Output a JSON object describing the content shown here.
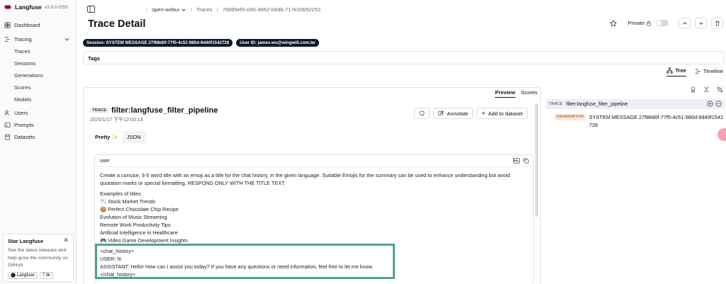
{
  "brand": {
    "name": "Langfuse",
    "version": "v3.8.0 OSS",
    "logo_color": "#c83c4f"
  },
  "sidebar": {
    "dashboard": "Dashboard",
    "tracing": "Tracing",
    "tracing_items": [
      "Traces",
      "Sessions",
      "Generations",
      "Scores",
      "Models"
    ],
    "users": "Users",
    "prompts": "Prompts",
    "datasets": "Datasets"
  },
  "star_card": {
    "title": "Star Langfuse",
    "text": "See the latest releases and help grow the community on GitHub",
    "github_label": "Langfuse",
    "github_count": "7.8k"
  },
  "breadcrumb": {
    "project": "open-webui",
    "section": "Traces",
    "trace_id": "76885ef9-cbfc-4662-b6db-717e20b52252"
  },
  "page_title": "Trace Detail",
  "privacy_label": "Private",
  "pills": {
    "session": "Session: SYSTEM MESSAGE 27f88d0f-77f5-4c51-980d-9d40f1542728",
    "user": "User ID: james.wu@wingwill.com.tw"
  },
  "tags_label": "Tags",
  "view_tabs": {
    "tree": "Tree",
    "timeline": "Timeline"
  },
  "main": {
    "tabs": {
      "preview": "Preview",
      "scores": "Scores"
    },
    "trace_badge": "TRACE",
    "trace_name": "filter:langfuse_filter_pipeline",
    "timestamp": "2025/1/17 下午12:03:13",
    "annotate": "Annotate",
    "add_dataset": "Add to dataset",
    "seg": {
      "pretty": "Pretty ✨",
      "json": "JSON"
    },
    "msg_role": "user",
    "instruction": "Create a concise, 3-5 word title with an emoji as a title for the chat history, in the given language. Suitable Emojis for the summary can be used to enhance understanding but avoid quotation marks or special formatting. RESPOND ONLY WITH THE TITLE TEXT.",
    "examples_heading": "Examples of titles:",
    "examples": [
      "📉 Stock Market Trends",
      "🍪 Perfect Chocolate Chip Recipe",
      "Evolution of Music Streaming",
      "Remote Work Productivity Tips",
      "Artificial Intelligence in Healthcare",
      "🎮 Video Game Development Insights"
    ],
    "chat_lines": [
      "<chat_history>",
      "USER: hi",
      "ASSISTANT: Hello! How can I assist you today? If you have any questions or need information, feel free to let me know.",
      "</chat_history>"
    ]
  },
  "tree": {
    "root_badge": "TRACE",
    "root_name": "filter:langfuse_filter_pipeline",
    "gen_badge": "GENERATION",
    "gen_name": "SYSTEM MESSAGE 27f88d0f-77f5-4c51-980d-9d40f1542728"
  },
  "colors": {
    "highlight": "#4fa38e",
    "pill_bg": "#0f1729",
    "gen_badge_bg": "#fbe8dc"
  }
}
